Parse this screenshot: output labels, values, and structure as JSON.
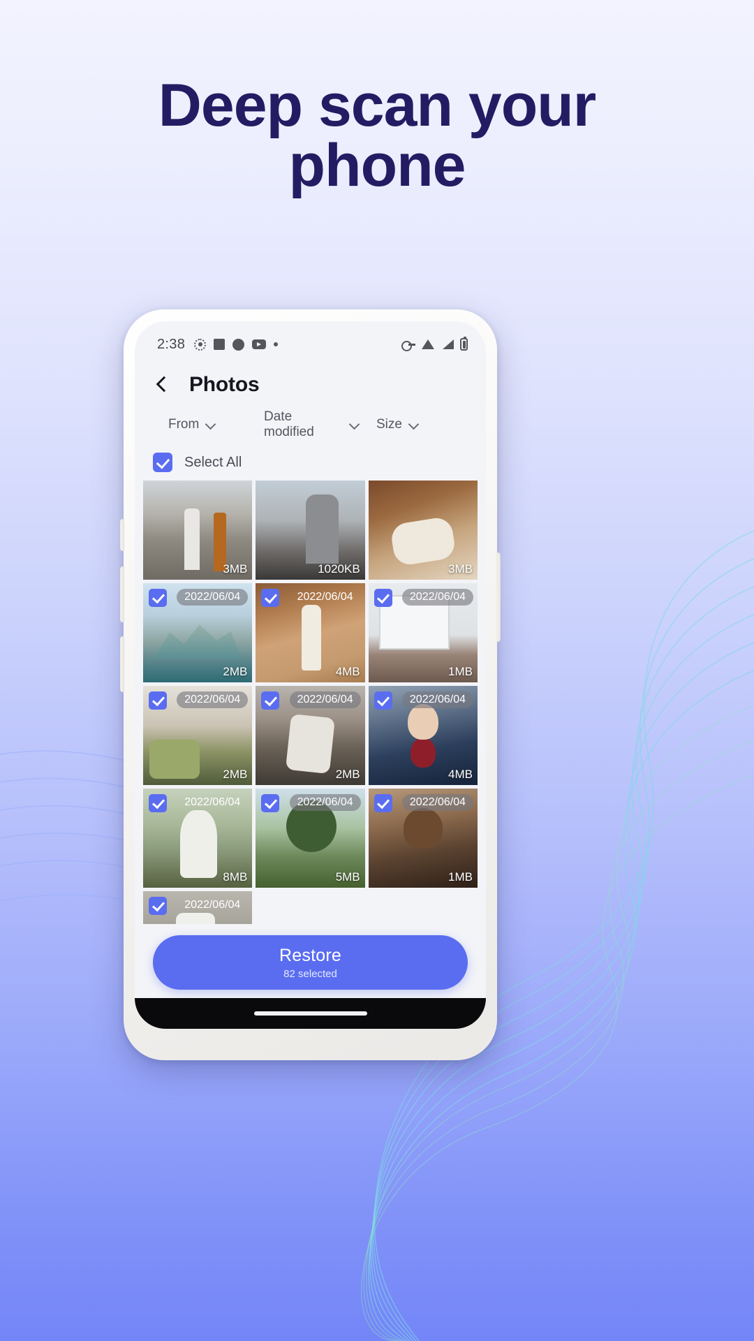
{
  "headline": {
    "line1": "Deep scan your",
    "line2": "phone"
  },
  "colors": {
    "accent": "#5a6df0",
    "headline": "#241c63",
    "screen_bg": "#f3f4f8",
    "status_icon": "#55555c"
  },
  "phone": {
    "statusbar": {
      "time": "2:38",
      "left_icons": [
        "record-icon",
        "square-icon",
        "circle-icon",
        "youtube-icon",
        "dot-icon"
      ],
      "right_icons": [
        "vpn-key-icon",
        "wifi-icon",
        "signal-icon",
        "battery-icon"
      ]
    },
    "header": {
      "back_icon": "back-chevron-icon",
      "title": "Photos"
    },
    "filters": [
      {
        "label": "From",
        "icon": "chevron-down-icon"
      },
      {
        "label": "Date modified",
        "icon": "chevron-down-icon"
      },
      {
        "label": "Size",
        "icon": "chevron-down-icon"
      }
    ],
    "select_all": {
      "label": "Select All",
      "checked": true
    },
    "photos": [
      {
        "art": "p1",
        "size": "3MB",
        "date": "",
        "checked": false,
        "date_style": "none"
      },
      {
        "art": "p2",
        "size": "1020KB",
        "date": "",
        "checked": false,
        "date_style": "none"
      },
      {
        "art": "p3",
        "size": "3MB",
        "date": "",
        "checked": false,
        "date_style": "none"
      },
      {
        "art": "p4",
        "size": "2MB",
        "date": "2022/06/04",
        "checked": true,
        "date_style": "badge"
      },
      {
        "art": "p5",
        "size": "4MB",
        "date": "2022/06/04",
        "checked": true,
        "date_style": "plain"
      },
      {
        "art": "p6",
        "size": "1MB",
        "date": "2022/06/04",
        "checked": true,
        "date_style": "badge"
      },
      {
        "art": "p7",
        "size": "2MB",
        "date": "2022/06/04",
        "checked": true,
        "date_style": "badge"
      },
      {
        "art": "p8",
        "size": "2MB",
        "date": "2022/06/04",
        "checked": true,
        "date_style": "badge"
      },
      {
        "art": "p9",
        "size": "4MB",
        "date": "2022/06/04",
        "checked": true,
        "date_style": "badge"
      },
      {
        "art": "p10",
        "size": "8MB",
        "date": "2022/06/04",
        "checked": true,
        "date_style": "plain"
      },
      {
        "art": "p11",
        "size": "5MB",
        "date": "2022/06/04",
        "checked": true,
        "date_style": "badge"
      },
      {
        "art": "p12",
        "size": "1MB",
        "date": "2022/06/04",
        "checked": true,
        "date_style": "badge"
      },
      {
        "art": "p13",
        "size": "",
        "date": "2022/06/04",
        "checked": true,
        "date_style": "plain"
      }
    ],
    "cta": {
      "label": "Restore",
      "sublabel": "82 selected"
    }
  }
}
